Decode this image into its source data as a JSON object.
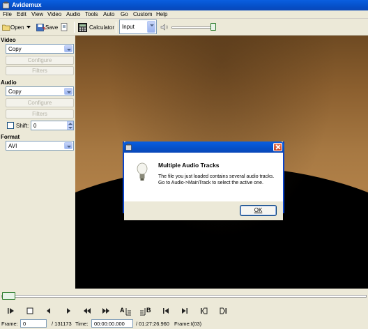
{
  "window": {
    "title": "Avidemux"
  },
  "menu": [
    "File",
    "Edit",
    "View",
    "Video",
    "Audio",
    "Tools",
    "Auto",
    "Go",
    "Custom",
    "Help"
  ],
  "toolbar": {
    "open_label": "Open",
    "save_label": "Save",
    "calculator_label": "Calculator",
    "input_select": "Input",
    "volume_level": 0.95
  },
  "left_panel": {
    "video_label": "Video",
    "video_codec": "Copy",
    "configure_label": "Configure",
    "filters_label": "Filters",
    "audio_label": "Audio",
    "audio_codec": "Copy",
    "audio_configure_label": "Configure",
    "audio_filters_label": "Filters",
    "shift_label": "Shift:",
    "shift_value": "0",
    "shift_checked": false,
    "format_label": "Format",
    "format_value": "AVI"
  },
  "dialog": {
    "heading": "Multiple Audio Tracks",
    "message_line1": "The file you just loaded contains several audio tracks.",
    "message_line2": "Go to Audio->MainTrack to select the active one.",
    "ok_label": "OK"
  },
  "playback": {
    "seek_position": 0.0,
    "buttons": [
      "play",
      "stop",
      "previous-frame",
      "next-frame",
      "rewind",
      "fast-forward",
      "mark-a",
      "mark-b",
      "previous-keyframe",
      "next-keyframe",
      "go-start",
      "go-end"
    ],
    "mark_a_label": "A",
    "mark_b_label": "B"
  },
  "status": {
    "frame_label": "Frame:",
    "frame_value": "0",
    "total_frames": "/ 131173",
    "time_label": "Time:",
    "time_value": "00:00:00.000",
    "duration": "/ 01:27:26.960",
    "frame_type": "Frame:I(03)"
  }
}
